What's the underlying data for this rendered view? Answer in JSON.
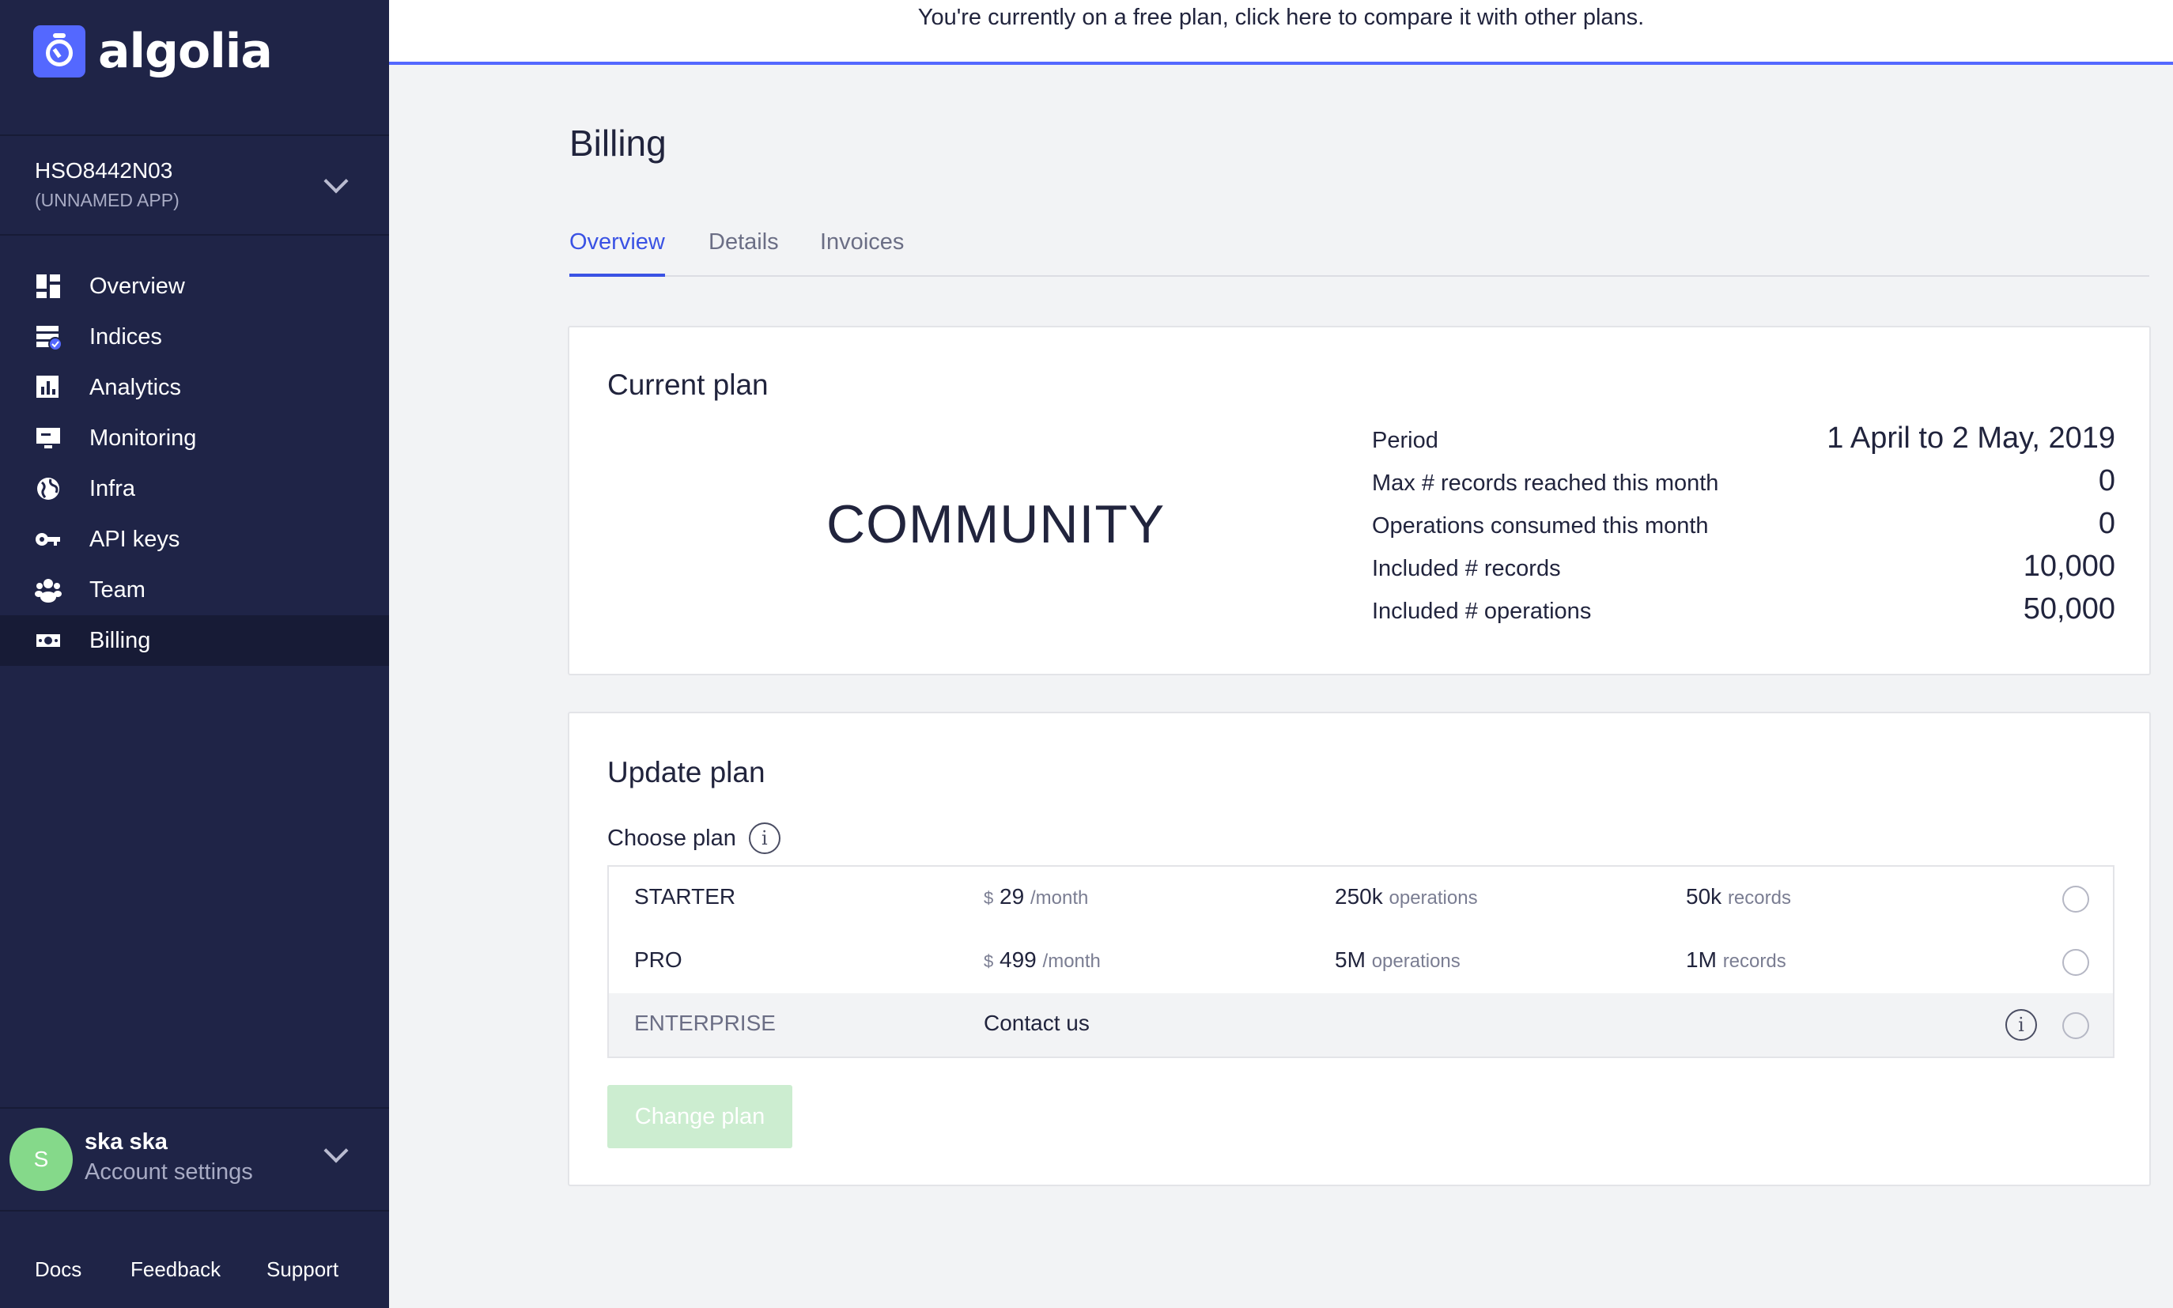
{
  "brand": {
    "name": "algolia",
    "accent": "#5468ff",
    "sidebar_bg": "#1f2447"
  },
  "app": {
    "id": "HSO8442N03",
    "name": "(UNNAMED APP)"
  },
  "nav": {
    "items": [
      {
        "label": "Overview",
        "icon": "dashboard-icon"
      },
      {
        "label": "Indices",
        "icon": "indices-icon"
      },
      {
        "label": "Analytics",
        "icon": "bar-chart-icon"
      },
      {
        "label": "Monitoring",
        "icon": "monitor-icon"
      },
      {
        "label": "Infra",
        "icon": "globe-icon"
      },
      {
        "label": "API keys",
        "icon": "key-icon"
      },
      {
        "label": "Team",
        "icon": "team-icon"
      },
      {
        "label": "Billing",
        "icon": "money-icon",
        "active": true
      }
    ]
  },
  "account": {
    "initial": "S",
    "name": "ska ska",
    "subtitle": "Account settings"
  },
  "footer": {
    "docs": "Docs",
    "feedback": "Feedback",
    "support": "Support"
  },
  "banner": {
    "text": "You're currently on a free plan, click here to compare it with other plans."
  },
  "page": {
    "title": "Billing",
    "tabs": [
      "Overview",
      "Details",
      "Invoices"
    ],
    "active_tab": "Overview"
  },
  "current_plan": {
    "title": "Current plan",
    "plan": "COMMUNITY",
    "stats": [
      {
        "label": "Period",
        "value": "1 April to 2 May, 2019"
      },
      {
        "label": "Max # records reached this month",
        "value": "0"
      },
      {
        "label": "Operations consumed this month",
        "value": "0"
      },
      {
        "label": "Included # records",
        "value": "10,000"
      },
      {
        "label": "Included # operations",
        "value": "50,000"
      }
    ]
  },
  "update_plan": {
    "title": "Update plan",
    "choose_label": "Choose plan",
    "info_glyph": "i",
    "plans": [
      {
        "name": "STARTER",
        "currency": "$",
        "price": "29",
        "period": "/month",
        "ops": "250k",
        "ops_unit": "operations",
        "records": "50k",
        "records_unit": "records"
      },
      {
        "name": "PRO",
        "currency": "$",
        "price": "499",
        "period": "/month",
        "ops": "5M",
        "ops_unit": "operations",
        "records": "1M",
        "records_unit": "records"
      },
      {
        "name": "ENTERPRISE",
        "contact": "Contact us"
      }
    ],
    "button": "Change plan"
  }
}
